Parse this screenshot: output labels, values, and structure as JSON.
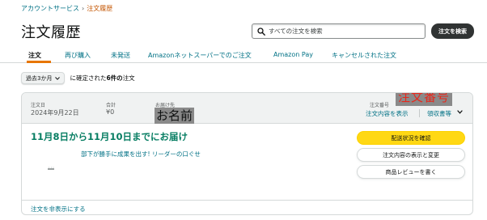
{
  "breadcrumb": {
    "parent": "アカウントサービス",
    "separator": "›",
    "current": "注文履歴"
  },
  "page_title": "注文履歴",
  "search": {
    "placeholder": "すべての注文を検索",
    "value": "",
    "button_label": "注文を検索"
  },
  "tabs": [
    {
      "label": "注文",
      "active": true
    },
    {
      "label": "再び購入",
      "active": false
    },
    {
      "label": "未発送",
      "active": false
    },
    {
      "label": "Amazonネットスーパーでのご注文",
      "active": false
    },
    {
      "label": "Amazon Pay",
      "active": false
    },
    {
      "label": "キャンセルされた注文",
      "active": false
    }
  ],
  "filter": {
    "selected": "過去3か月",
    "prefix": "に確定された",
    "count": "6件の",
    "suffix": "注文"
  },
  "order": {
    "date_label": "注文日",
    "date_value": "2024年9月22日",
    "total_label": "合計",
    "total_value": "¥0",
    "ship_to_label": "お届け先",
    "ship_to_redacted": "お名前",
    "order_number_label": "注文番号",
    "order_number_redacted": "注文番号",
    "details_link": "注文内容を表示",
    "receipt_link": "領収書等",
    "delivery_title": "11月8日から11月10日までにお届け",
    "item_title": "部下が勝手に成果を出す! リーダーの口ぐせ",
    "buttons": {
      "track": "配送状況を確認",
      "view_change": "注文内容の表示と変更",
      "review": "商品レビューを書く"
    },
    "hide_link": "注文を非表示にする"
  },
  "colors": {
    "link": "#007185",
    "accent_orange": "#e77600",
    "delivery_green": "#067d62",
    "primary_button": "#ffd814",
    "redaction_text": "#e8271b"
  },
  "icons": {
    "search": "search-icon",
    "select_chevron": "chevron-down-icon",
    "receipt_chevron": "chevron-down-icon"
  }
}
